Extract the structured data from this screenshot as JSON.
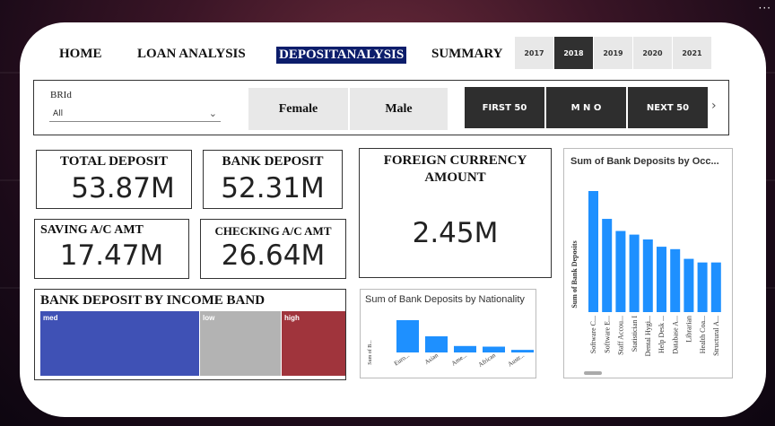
{
  "nav": {
    "home": "HOME",
    "loan_analysis": "LOAN ANALYSIS",
    "deposit_analysis": "DEPOSITANALYSIS",
    "summary": "SUMMARY"
  },
  "years": [
    "2017",
    "2018",
    "2019",
    "2020",
    "2021"
  ],
  "selected_year": "2018",
  "filters": {
    "brid_label": "BRId",
    "brid_value": "All",
    "female": "Female",
    "male": "Male",
    "first_50": "FIRST 50",
    "mno": "M N O",
    "next_50": "NEXT 50"
  },
  "kpis": {
    "total_deposit": {
      "label": "TOTAL DEPOSIT",
      "value": "53.87M"
    },
    "bank_deposit": {
      "label": "BANK DEPOSIT",
      "value": "52.31M"
    },
    "foreign_currency_line1": "FOREIGN CURRENCY",
    "foreign_currency_line2": "AMOUNT",
    "foreign_currency_value": "2.45M",
    "saving": {
      "label": "SAVING A/C AMT",
      "value": "17.47M"
    },
    "checking": {
      "label": "CHECKING A/C AMT",
      "value": "26.64M"
    }
  },
  "colors": {
    "accent_blue": "#1e90ff",
    "nav_active": "#0c1d6b",
    "tile_med": "#3f51b5",
    "tile_low": "#b3b3b3",
    "tile_high": "#a0343c"
  },
  "chart_data": [
    {
      "type": "treemap",
      "title": "BANK DEPOSIT BY INCOME BAND",
      "categories": [
        "med",
        "low",
        "high"
      ],
      "values": [
        0.51,
        0.23,
        0.17
      ]
    },
    {
      "type": "bar",
      "title": "Sum of Bank Deposits by Nationality",
      "ylabel": "Sum of B...",
      "categories": [
        "Euro...",
        "Asian",
        "Ame...",
        "African",
        "Austr..."
      ],
      "values": [
        100,
        50,
        20,
        18,
        8
      ]
    },
    {
      "type": "bar",
      "title": "Sum of Bank Deposits by Occ...",
      "ylabel": "Sum of Bank Deposits",
      "categories": [
        "Software C...",
        "Software E...",
        "Staff Accou...",
        "Statistician I",
        "Dental Hygi...",
        "Help Desk ...",
        "Database A...",
        "Librarian",
        "Health Coa...",
        "Structural A..."
      ],
      "values": [
        100,
        77,
        67,
        64,
        60,
        54,
        52,
        44,
        41,
        41
      ]
    }
  ]
}
